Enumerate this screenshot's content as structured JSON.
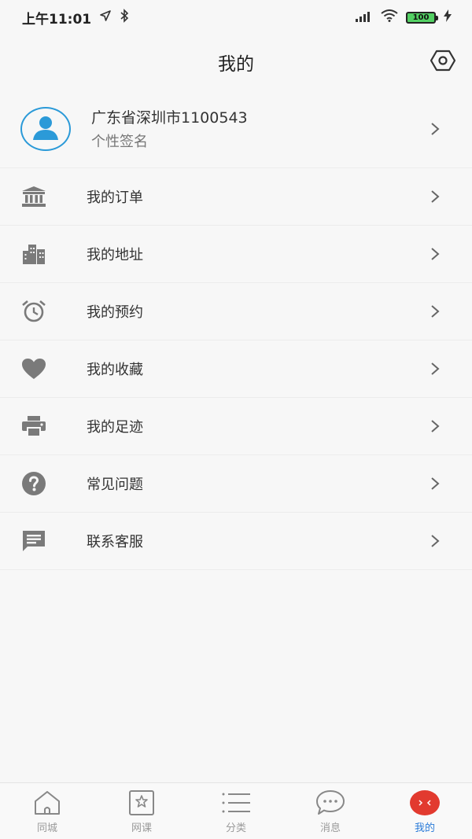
{
  "status": {
    "time": "上午11:01",
    "battery": "100"
  },
  "header": {
    "title": "我的"
  },
  "profile": {
    "name": "广东省深圳市1100543",
    "signature": "个性签名"
  },
  "menu": [
    {
      "label": "我的订单",
      "icon": "bank-icon"
    },
    {
      "label": "我的地址",
      "icon": "city-building-icon"
    },
    {
      "label": "我的预约",
      "icon": "alarm-clock-icon"
    },
    {
      "label": "我的收藏",
      "icon": "heart-icon"
    },
    {
      "label": "我的足迹",
      "icon": "printer-icon"
    },
    {
      "label": "常见问题",
      "icon": "help-circle-icon"
    },
    {
      "label": "联系客服",
      "icon": "chat-bubble-icon"
    }
  ],
  "tabbar": {
    "tabs": [
      {
        "label": "同城",
        "icon": "home-icon"
      },
      {
        "label": "网课",
        "icon": "star-frame-icon"
      },
      {
        "label": "分类",
        "icon": "list-icon"
      },
      {
        "label": "消息",
        "icon": "message-icon"
      },
      {
        "label": "我的",
        "icon": "profile-face-icon",
        "active": true
      }
    ]
  },
  "colors": {
    "accent_blue": "#2b9ad8",
    "active_tab_text": "#2b7bd8",
    "active_tab_badge": "#e23a2f",
    "icon_gray": "#7a7a7a",
    "background": "#f7f7f7"
  }
}
